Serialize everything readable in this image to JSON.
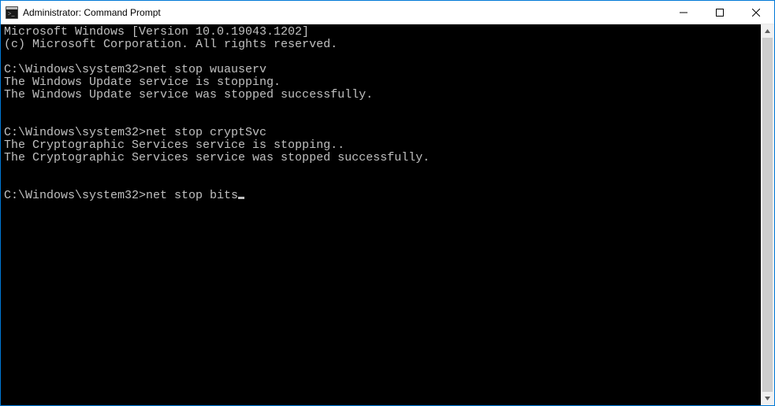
{
  "window": {
    "title": "Administrator: Command Prompt"
  },
  "terminal": {
    "lines": [
      "Microsoft Windows [Version 10.0.19043.1202]",
      "(c) Microsoft Corporation. All rights reserved.",
      "",
      "C:\\Windows\\system32>net stop wuauserv",
      "The Windows Update service is stopping.",
      "The Windows Update service was stopped successfully.",
      "",
      "",
      "C:\\Windows\\system32>net stop cryptSvc",
      "The Cryptographic Services service is stopping..",
      "The Cryptographic Services service was stopped successfully.",
      "",
      "",
      "C:\\Windows\\system32>net stop bits"
    ],
    "cursor_after_last": true
  }
}
